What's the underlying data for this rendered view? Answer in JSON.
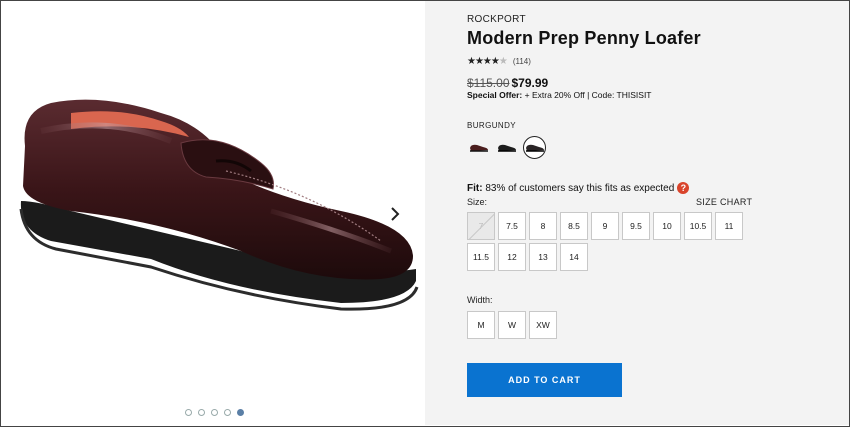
{
  "product": {
    "brand": "ROCKPORT",
    "title": "Modern Prep Penny Loafer",
    "rating_stars": 4,
    "rating_count": "(114)",
    "old_price": "$115.00",
    "new_price": "$79.99",
    "offer_label": "Special Offer:",
    "offer_text": " + Extra 20% Off | Code: THISISIT"
  },
  "color": {
    "label": "BURGUNDY",
    "swatches": [
      {
        "name": "burgundy",
        "hex": "#4a1d1d",
        "selected": false
      },
      {
        "name": "black",
        "hex": "#1c1c1c",
        "selected": false
      },
      {
        "name": "dark",
        "hex": "#2a2526",
        "selected": true
      }
    ]
  },
  "fit": {
    "label": "Fit:",
    "text": " 83% of customers say this fits as expected",
    "help": "?"
  },
  "size": {
    "label": "Size:",
    "chart_link": "SIZE CHART",
    "options": [
      "7",
      "7.5",
      "8",
      "8.5",
      "9",
      "9.5",
      "10",
      "10.5",
      "11",
      "11.5",
      "12",
      "13",
      "14"
    ],
    "unavailable": [
      "7"
    ]
  },
  "width": {
    "label": "Width:",
    "options": [
      "M",
      "W",
      "XW"
    ]
  },
  "cart": {
    "button_label": "ADD TO CART"
  },
  "gallery": {
    "dot_count": 5,
    "active_dot": 4
  },
  "colors": {
    "accent": "#0a73d0",
    "help": "#d9442b",
    "panel_bg": "#f3f3f3"
  }
}
